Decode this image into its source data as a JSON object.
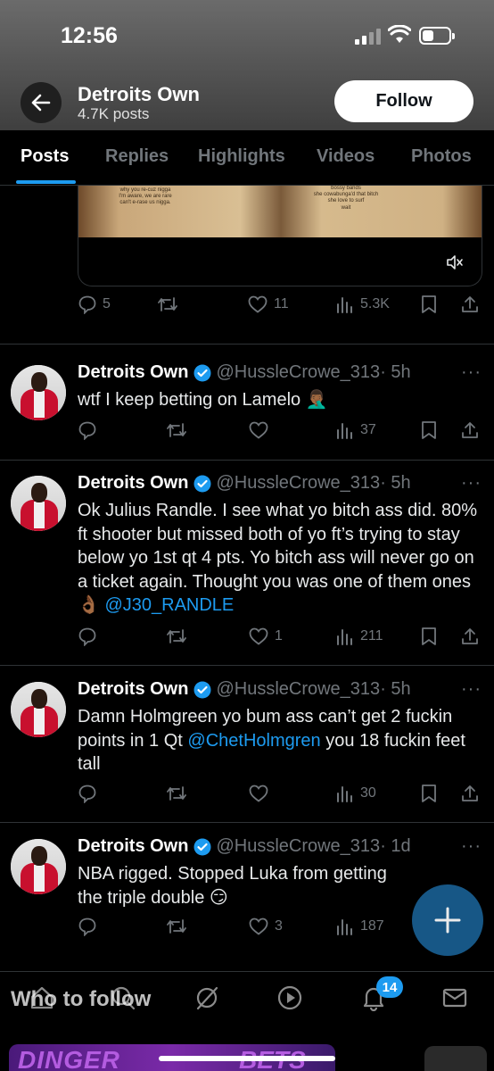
{
  "status_bar": {
    "time": "12:56"
  },
  "header": {
    "name": "Detroits Own",
    "post_count": "4.7K posts",
    "follow_label": "Follow"
  },
  "tabs": [
    {
      "label": "Posts",
      "active": true
    },
    {
      "label": "Replies"
    },
    {
      "label": "Highlights"
    },
    {
      "label": "Videos"
    },
    {
      "label": "Photos"
    }
  ],
  "media_post": {
    "image_text_left": "why you re-cuz nigga\nI'm aware, we are rare\ncan't e-rase us nigga.",
    "image_text_right": "bossy bands\nshe cowabunga'd that bitch\nshe love to surf\nwait",
    "stats": {
      "replies": "5",
      "reposts": "",
      "likes": "11",
      "views": "5.3K"
    }
  },
  "tweets": [
    {
      "name": "Detroits Own",
      "handle": "@HussleCrowe_313",
      "time": "· 5h",
      "text": "wtf I keep betting on Lamelo 🤦🏾‍♂️",
      "stats": {
        "replies": "",
        "reposts": "",
        "likes": "",
        "views": "37"
      }
    },
    {
      "name": "Detroits Own",
      "handle": "@HussleCrowe_313",
      "time": "· 5h",
      "text": "Ok Julius Randle. I see what yo bitch ass did. 80% ft shooter but missed both of yo ft’s trying to stay below yo 1st qt 4 pts. Yo bitch ass will never go on a ticket again. Thought you was one of them ones 👌🏾 ",
      "mention": "@J30_RANDLE",
      "stats": {
        "replies": "",
        "reposts": "",
        "likes": "1",
        "views": "211"
      }
    },
    {
      "name": "Detroits Own",
      "handle": "@HussleCrowe_313",
      "time": "· 5h",
      "text_before": "Damn Holmgreen yo bum ass can’t get 2 fuckin points in 1 Qt ",
      "mention": "@ChetHolmgren",
      "text_after": " you 18 fuckin feet tall",
      "stats": {
        "replies": "",
        "reposts": "",
        "likes": "",
        "views": "30"
      }
    },
    {
      "name": "Detroits Own",
      "handle": "@HussleCrowe_313",
      "time": "· 1d",
      "text": "NBA rigged. Stopped Luka from getting the triple double 😏",
      "stats": {
        "replies": "",
        "reposts": "",
        "likes": "3",
        "views": "187"
      }
    }
  ],
  "bottom_nav": {
    "notifications_badge": "14",
    "who_to_follow": "Who to follow"
  },
  "promo": {
    "left_text": "DINGER",
    "right_text": "BETS"
  },
  "colors": {
    "accent": "#1d9bf0",
    "muted": "#71767b",
    "text": "#e7e9ea",
    "divider": "#2f3336"
  }
}
